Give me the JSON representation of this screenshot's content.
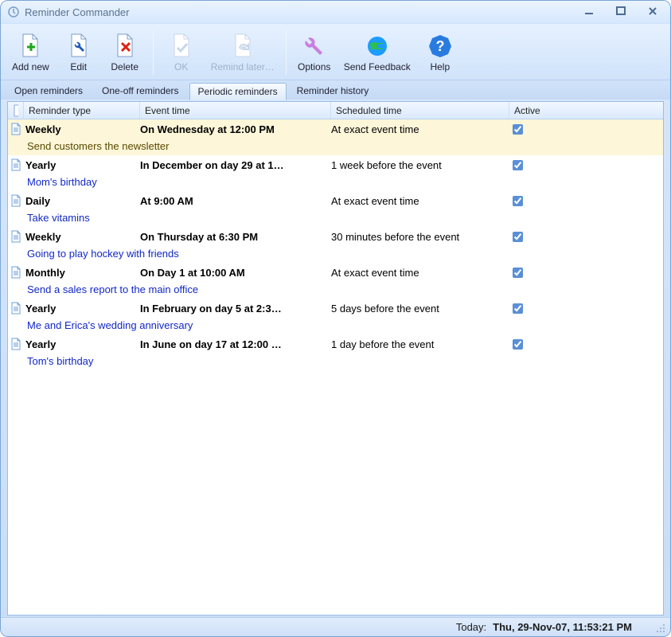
{
  "window": {
    "title": "Reminder Commander"
  },
  "toolbar": {
    "add_new": "Add new",
    "edit": "Edit",
    "delete": "Delete",
    "ok": "OK",
    "remind_later": "Remind later…",
    "options": "Options",
    "send_feedback": "Send Feedback",
    "help": "Help"
  },
  "tabs": {
    "open": "Open reminders",
    "one_off": "One-off reminders",
    "periodic": "Periodic reminders",
    "history": "Reminder history",
    "active_index": 2
  },
  "columns": {
    "type": "Reminder type",
    "event": "Event time",
    "scheduled": "Scheduled time",
    "active": "Active"
  },
  "rows": [
    {
      "type": "Weekly",
      "event": "On Wednesday at 12:00 PM",
      "scheduled": "At exact event time",
      "active": true,
      "desc": "Send customers the newsletter",
      "selected": true
    },
    {
      "type": "Yearly",
      "event": "In December on day 29 at 1…",
      "scheduled": "1 week before the event",
      "active": true,
      "desc": "Mom's birthday"
    },
    {
      "type": "Daily",
      "event": "At 9:00 AM",
      "scheduled": "At exact event time",
      "active": true,
      "desc": "Take vitamins"
    },
    {
      "type": "Weekly",
      "event": "On Thursday at 6:30 PM",
      "scheduled": "30 minutes before the event",
      "active": true,
      "desc": "Going to play hockey with friends"
    },
    {
      "type": "Monthly",
      "event": "On Day 1 at 10:00 AM",
      "scheduled": "At exact event time",
      "active": true,
      "desc": "Send a sales report to the main office"
    },
    {
      "type": "Yearly",
      "event": "In February on day 5 at 2:3…",
      "scheduled": "5 days before the event",
      "active": true,
      "desc": "Me and Erica's wedding anniversary"
    },
    {
      "type": "Yearly",
      "event": "In June on day 17 at 12:00 …",
      "scheduled": "1 day before the event",
      "active": true,
      "desc": "Tom's birthday"
    }
  ],
  "status": {
    "label": "Today:",
    "value": "Thu, 29-Nov-07, 11:53:21 PM"
  }
}
